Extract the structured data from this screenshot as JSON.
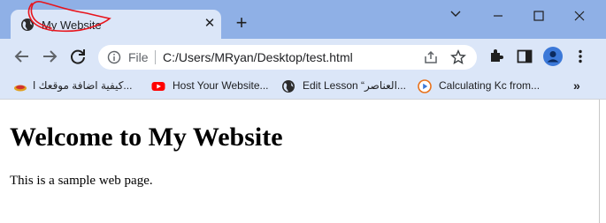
{
  "tab": {
    "title": "My Website",
    "favicon": "globe-icon",
    "close": "✕"
  },
  "new_tab": "+",
  "window_controls": [
    "chevron-down-icon",
    "minimize-icon",
    "maximize-icon",
    "close-icon"
  ],
  "toolbar": {
    "nav_icons": [
      "back-arrow-icon",
      "forward-arrow-icon",
      "reload-icon"
    ],
    "omnibox": {
      "scheme_label": "File",
      "url": "C:/Users/MRyan/Desktop/test.html"
    },
    "right_icons": [
      "share-icon",
      "star-icon",
      "extensions-icon",
      "side-panel-icon",
      "profile-icon",
      "more-vert-icon"
    ]
  },
  "bookmarks": [
    {
      "label": "كيفية اضافة موقعك ا...",
      "icon": "tube-icon"
    },
    {
      "label": "Host Your Website...",
      "icon": "youtube-icon"
    },
    {
      "label": "Edit Lesson “العناصر...",
      "icon": "globe-icon"
    },
    {
      "label": "Calculating Kc from...",
      "icon": "play-icon"
    }
  ],
  "bookmarks_more": "»",
  "page": {
    "heading": "Welcome to My Website",
    "paragraph": "This is a sample web page."
  },
  "colors": {
    "tabstrip": "#8fb0e6",
    "toolbar": "#dbe6f8",
    "annotation": "#e8141c",
    "profile": "#3b78d8"
  }
}
